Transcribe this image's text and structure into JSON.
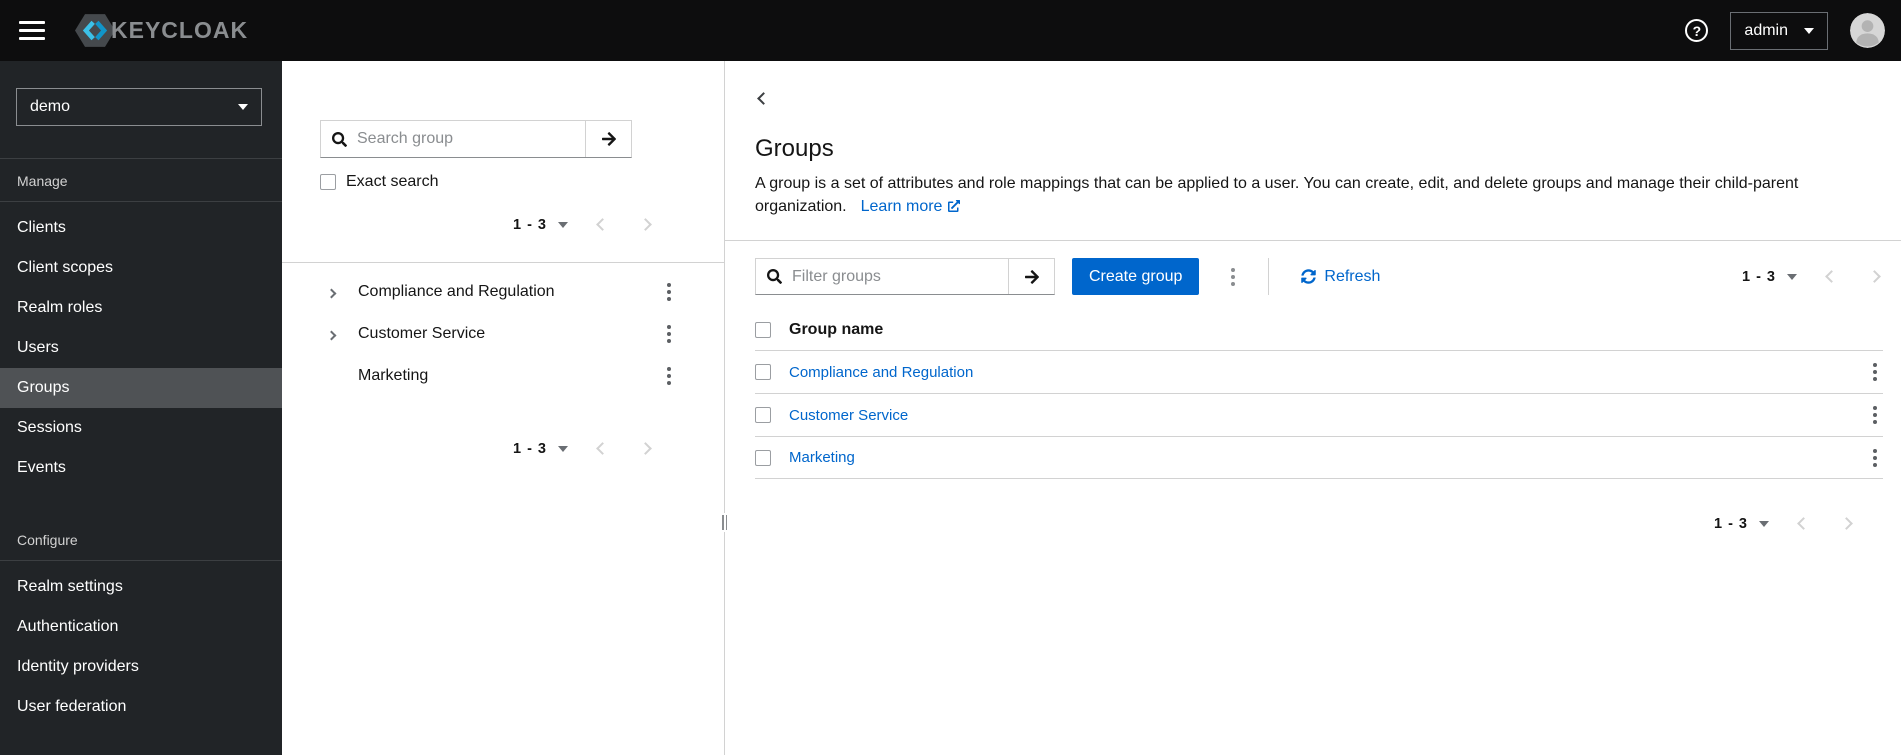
{
  "topbar": {
    "brand": "KEYCLOAK",
    "help_glyph": "?",
    "user": {
      "label": "admin"
    }
  },
  "sidebar": {
    "realm": {
      "value": "demo"
    },
    "sections": [
      {
        "title": "Manage",
        "items": [
          "Clients",
          "Client scopes",
          "Realm roles",
          "Users",
          "Groups",
          "Sessions",
          "Events"
        ]
      },
      {
        "title": "Configure",
        "items": [
          "Realm settings",
          "Authentication",
          "Identity providers",
          "User federation"
        ]
      }
    ],
    "active_item": "Groups"
  },
  "tree_panel": {
    "search_placeholder": "Search group",
    "exact_search_label": "Exact search",
    "pagination": {
      "range": "1 - 3"
    },
    "rows": [
      {
        "name": "Compliance and Regulation",
        "expandable": true
      },
      {
        "name": "Customer Service",
        "expandable": true
      },
      {
        "name": "Marketing",
        "expandable": false
      }
    ],
    "footer_pagination": {
      "range": "1 - 3"
    }
  },
  "main": {
    "title": "Groups",
    "description": "A group is a set of attributes and role mappings that can be applied to a user. You can create, edit, and delete groups and manage their child-parent organization.",
    "learn_more": "Learn more",
    "toolbar": {
      "filter_placeholder": "Filter groups",
      "create_label": "Create group",
      "refresh_label": "Refresh",
      "pagination": {
        "range": "1 - 3"
      }
    },
    "table": {
      "header": "Group name",
      "rows": [
        "Compliance and Regulation",
        "Customer Service",
        "Marketing"
      ]
    },
    "footer_pagination": {
      "range": "1 - 3"
    }
  },
  "colors": {
    "accent": "#0066cc",
    "link": "#0066cc",
    "masthead_bg": "#0d0d0e",
    "sidebar_bg": "#212427",
    "sidebar_active_bg": "#4f5255",
    "border": "#d2d2d2",
    "text": "#151515",
    "muted": "#6a6e73"
  }
}
